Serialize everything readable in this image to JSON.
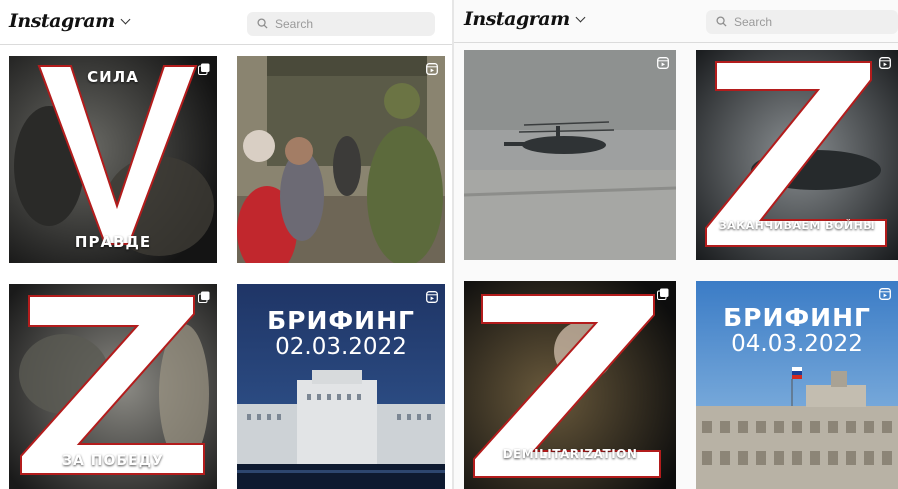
{
  "colors": {
    "accent": "#ffffff",
    "briefing_blue": "#1f3f7a",
    "briefing_blue_light": "#4b8ed1"
  },
  "left": {
    "header": {
      "logo": "Instagram",
      "search_placeholder": "Search"
    },
    "tiles": [
      {
        "type": "slogan",
        "caption_top": "СИЛА",
        "caption_bottom": "ПРАВДЕ",
        "badge": "carousel-icon"
      },
      {
        "type": "photo",
        "badge": "reel-icon"
      },
      {
        "type": "slogan",
        "caption_bottom": "ЗА ПОБЕДУ",
        "badge": "carousel-icon"
      },
      {
        "type": "briefing",
        "title": "БРИФИНГ",
        "date": "02.03.2022",
        "badge": "reel-icon"
      }
    ]
  },
  "right": {
    "header": {
      "logo": "Instagram",
      "search_placeholder": "Search"
    },
    "tiles": [
      {
        "type": "photo",
        "badge": "reel-icon"
      },
      {
        "type": "slogan",
        "caption_bottom": "ЗАКАНЧИВАЕМ ВОЙНЫ",
        "badge": "reel-icon"
      },
      {
        "type": "slogan",
        "caption_bottom": "DEMILITARIZATION",
        "badge": "carousel-icon"
      },
      {
        "type": "briefing",
        "title": "БРИФИНГ",
        "date": "04.03.2022",
        "badge": "reel-icon"
      }
    ]
  }
}
